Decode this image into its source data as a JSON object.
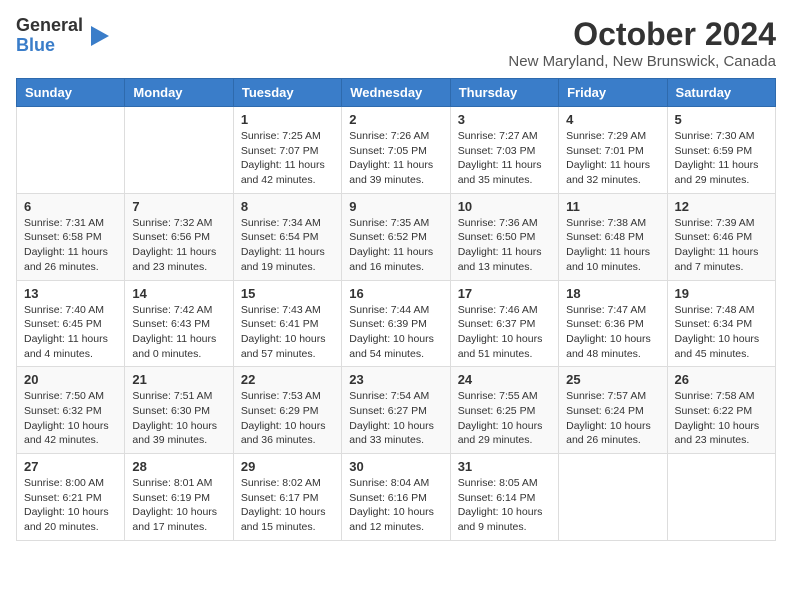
{
  "logo": {
    "general": "General",
    "blue": "Blue"
  },
  "title": "October 2024",
  "subtitle": "New Maryland, New Brunswick, Canada",
  "days_of_week": [
    "Sunday",
    "Monday",
    "Tuesday",
    "Wednesday",
    "Thursday",
    "Friday",
    "Saturday"
  ],
  "weeks": [
    [
      {
        "day": "",
        "sunrise": "",
        "sunset": "",
        "daylight": ""
      },
      {
        "day": "",
        "sunrise": "",
        "sunset": "",
        "daylight": ""
      },
      {
        "day": "1",
        "sunrise": "Sunrise: 7:25 AM",
        "sunset": "Sunset: 7:07 PM",
        "daylight": "Daylight: 11 hours and 42 minutes."
      },
      {
        "day": "2",
        "sunrise": "Sunrise: 7:26 AM",
        "sunset": "Sunset: 7:05 PM",
        "daylight": "Daylight: 11 hours and 39 minutes."
      },
      {
        "day": "3",
        "sunrise": "Sunrise: 7:27 AM",
        "sunset": "Sunset: 7:03 PM",
        "daylight": "Daylight: 11 hours and 35 minutes."
      },
      {
        "day": "4",
        "sunrise": "Sunrise: 7:29 AM",
        "sunset": "Sunset: 7:01 PM",
        "daylight": "Daylight: 11 hours and 32 minutes."
      },
      {
        "day": "5",
        "sunrise": "Sunrise: 7:30 AM",
        "sunset": "Sunset: 6:59 PM",
        "daylight": "Daylight: 11 hours and 29 minutes."
      }
    ],
    [
      {
        "day": "6",
        "sunrise": "Sunrise: 7:31 AM",
        "sunset": "Sunset: 6:58 PM",
        "daylight": "Daylight: 11 hours and 26 minutes."
      },
      {
        "day": "7",
        "sunrise": "Sunrise: 7:32 AM",
        "sunset": "Sunset: 6:56 PM",
        "daylight": "Daylight: 11 hours and 23 minutes."
      },
      {
        "day": "8",
        "sunrise": "Sunrise: 7:34 AM",
        "sunset": "Sunset: 6:54 PM",
        "daylight": "Daylight: 11 hours and 19 minutes."
      },
      {
        "day": "9",
        "sunrise": "Sunrise: 7:35 AM",
        "sunset": "Sunset: 6:52 PM",
        "daylight": "Daylight: 11 hours and 16 minutes."
      },
      {
        "day": "10",
        "sunrise": "Sunrise: 7:36 AM",
        "sunset": "Sunset: 6:50 PM",
        "daylight": "Daylight: 11 hours and 13 minutes."
      },
      {
        "day": "11",
        "sunrise": "Sunrise: 7:38 AM",
        "sunset": "Sunset: 6:48 PM",
        "daylight": "Daylight: 11 hours and 10 minutes."
      },
      {
        "day": "12",
        "sunrise": "Sunrise: 7:39 AM",
        "sunset": "Sunset: 6:46 PM",
        "daylight": "Daylight: 11 hours and 7 minutes."
      }
    ],
    [
      {
        "day": "13",
        "sunrise": "Sunrise: 7:40 AM",
        "sunset": "Sunset: 6:45 PM",
        "daylight": "Daylight: 11 hours and 4 minutes."
      },
      {
        "day": "14",
        "sunrise": "Sunrise: 7:42 AM",
        "sunset": "Sunset: 6:43 PM",
        "daylight": "Daylight: 11 hours and 0 minutes."
      },
      {
        "day": "15",
        "sunrise": "Sunrise: 7:43 AM",
        "sunset": "Sunset: 6:41 PM",
        "daylight": "Daylight: 10 hours and 57 minutes."
      },
      {
        "day": "16",
        "sunrise": "Sunrise: 7:44 AM",
        "sunset": "Sunset: 6:39 PM",
        "daylight": "Daylight: 10 hours and 54 minutes."
      },
      {
        "day": "17",
        "sunrise": "Sunrise: 7:46 AM",
        "sunset": "Sunset: 6:37 PM",
        "daylight": "Daylight: 10 hours and 51 minutes."
      },
      {
        "day": "18",
        "sunrise": "Sunrise: 7:47 AM",
        "sunset": "Sunset: 6:36 PM",
        "daylight": "Daylight: 10 hours and 48 minutes."
      },
      {
        "day": "19",
        "sunrise": "Sunrise: 7:48 AM",
        "sunset": "Sunset: 6:34 PM",
        "daylight": "Daylight: 10 hours and 45 minutes."
      }
    ],
    [
      {
        "day": "20",
        "sunrise": "Sunrise: 7:50 AM",
        "sunset": "Sunset: 6:32 PM",
        "daylight": "Daylight: 10 hours and 42 minutes."
      },
      {
        "day": "21",
        "sunrise": "Sunrise: 7:51 AM",
        "sunset": "Sunset: 6:30 PM",
        "daylight": "Daylight: 10 hours and 39 minutes."
      },
      {
        "day": "22",
        "sunrise": "Sunrise: 7:53 AM",
        "sunset": "Sunset: 6:29 PM",
        "daylight": "Daylight: 10 hours and 36 minutes."
      },
      {
        "day": "23",
        "sunrise": "Sunrise: 7:54 AM",
        "sunset": "Sunset: 6:27 PM",
        "daylight": "Daylight: 10 hours and 33 minutes."
      },
      {
        "day": "24",
        "sunrise": "Sunrise: 7:55 AM",
        "sunset": "Sunset: 6:25 PM",
        "daylight": "Daylight: 10 hours and 29 minutes."
      },
      {
        "day": "25",
        "sunrise": "Sunrise: 7:57 AM",
        "sunset": "Sunset: 6:24 PM",
        "daylight": "Daylight: 10 hours and 26 minutes."
      },
      {
        "day": "26",
        "sunrise": "Sunrise: 7:58 AM",
        "sunset": "Sunset: 6:22 PM",
        "daylight": "Daylight: 10 hours and 23 minutes."
      }
    ],
    [
      {
        "day": "27",
        "sunrise": "Sunrise: 8:00 AM",
        "sunset": "Sunset: 6:21 PM",
        "daylight": "Daylight: 10 hours and 20 minutes."
      },
      {
        "day": "28",
        "sunrise": "Sunrise: 8:01 AM",
        "sunset": "Sunset: 6:19 PM",
        "daylight": "Daylight: 10 hours and 17 minutes."
      },
      {
        "day": "29",
        "sunrise": "Sunrise: 8:02 AM",
        "sunset": "Sunset: 6:17 PM",
        "daylight": "Daylight: 10 hours and 15 minutes."
      },
      {
        "day": "30",
        "sunrise": "Sunrise: 8:04 AM",
        "sunset": "Sunset: 6:16 PM",
        "daylight": "Daylight: 10 hours and 12 minutes."
      },
      {
        "day": "31",
        "sunrise": "Sunrise: 8:05 AM",
        "sunset": "Sunset: 6:14 PM",
        "daylight": "Daylight: 10 hours and 9 minutes."
      },
      {
        "day": "",
        "sunrise": "",
        "sunset": "",
        "daylight": ""
      },
      {
        "day": "",
        "sunrise": "",
        "sunset": "",
        "daylight": ""
      }
    ]
  ]
}
